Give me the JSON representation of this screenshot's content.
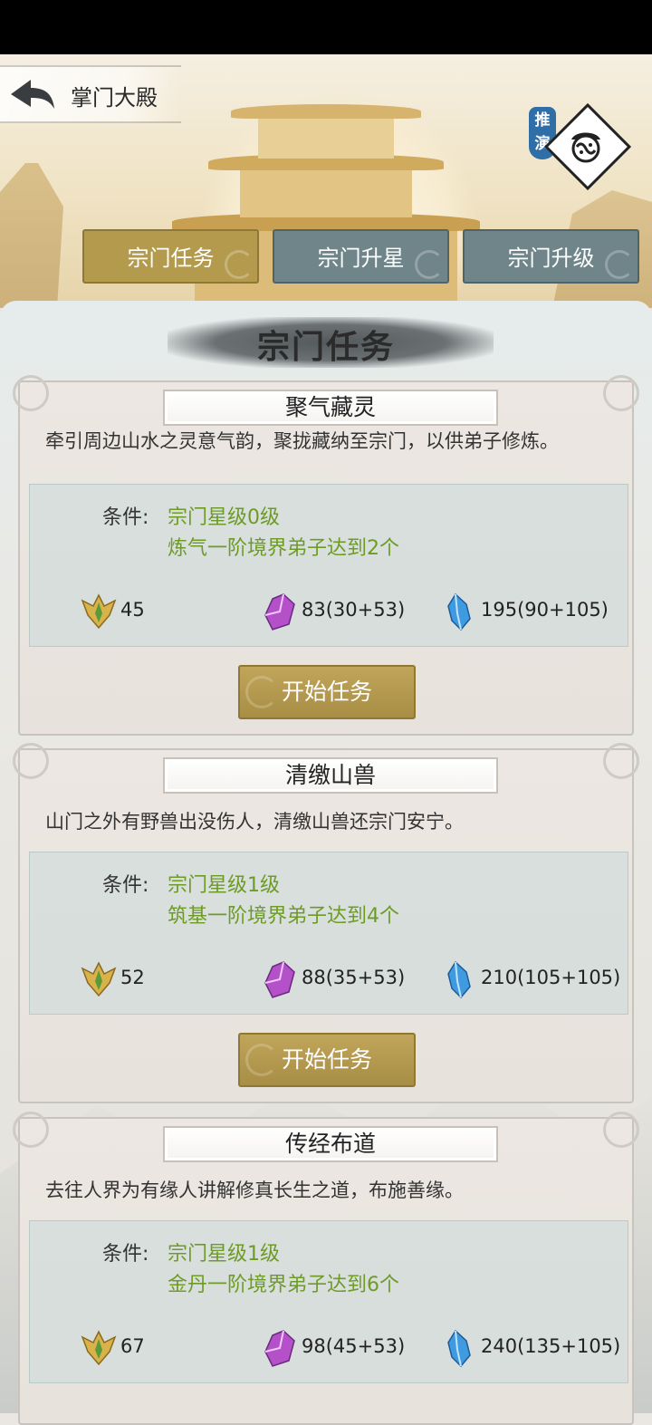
{
  "header": {
    "title": "掌门大殿",
    "tuiyan_label": "推演"
  },
  "tabs": [
    {
      "label": "宗门任务",
      "active": true
    },
    {
      "label": "宗门升星",
      "active": false
    },
    {
      "label": "宗门升级",
      "active": false
    }
  ],
  "section_title": "宗门任务",
  "tasks": [
    {
      "name": "聚气藏灵",
      "description": "牵引周边山水之灵意气韵，聚拢藏纳至宗门，以供弟子修炼。",
      "condition_label": "条件:",
      "conditions": [
        "宗门星级0级",
        "炼气一阶境界弟子达到2个"
      ],
      "rewards": {
        "emblem": "45",
        "purple_crystal": "83(30+53)",
        "blue_crystal": "195(90+105)"
      },
      "button": "开始任务"
    },
    {
      "name": "清缴山兽",
      "description": "山门之外有野兽出没伤人，清缴山兽还宗门安宁。",
      "condition_label": "条件:",
      "conditions": [
        "宗门星级1级",
        "筑基一阶境界弟子达到4个"
      ],
      "rewards": {
        "emblem": "52",
        "purple_crystal": "88(35+53)",
        "blue_crystal": "210(105+105)"
      },
      "button": "开始任务"
    },
    {
      "name": "传经布道",
      "description": "去往人界为有缘人讲解修真长生之道，布施善缘。",
      "condition_label": "条件:",
      "conditions": [
        "宗门星级1级",
        "金丹一阶境界弟子达到6个"
      ],
      "rewards": {
        "emblem": "67",
        "purple_crystal": "98(45+53)",
        "blue_crystal": "240(135+105)"
      }
    }
  ],
  "colors": {
    "active_tab": "#b39a4d",
    "inactive_tab": "#6f858a",
    "condition_green": "#6e9b28",
    "button_gold": "#b39a4d"
  },
  "icons": [
    "back-arrow-icon",
    "tuiyan-face-icon",
    "gold-emblem-icon",
    "purple-crystal-icon",
    "blue-crystal-icon"
  ]
}
